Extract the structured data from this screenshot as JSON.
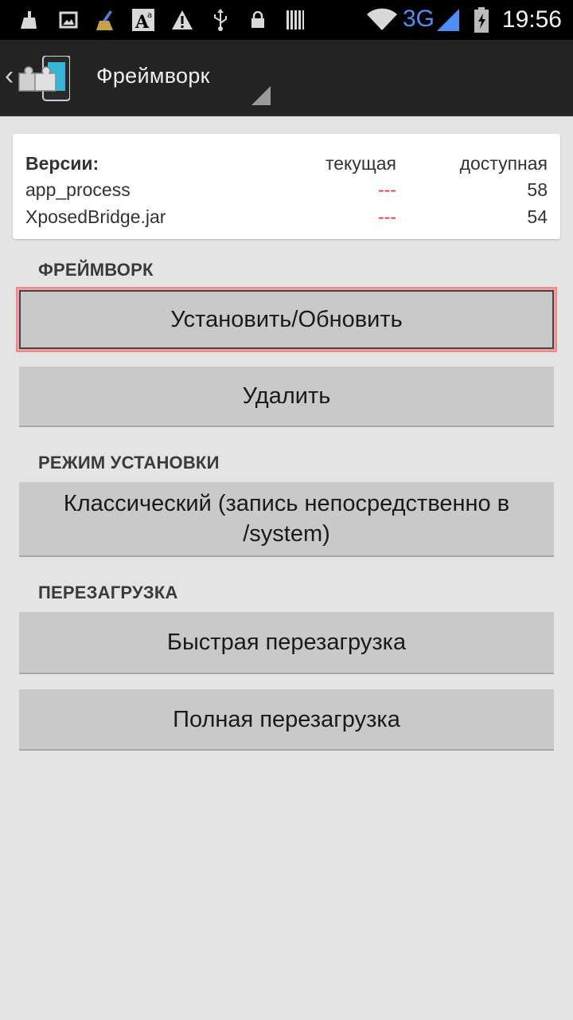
{
  "status_bar": {
    "time": "19:56",
    "network": "3G",
    "icons": [
      "cleaner-icon",
      "image-icon",
      "broom-icon",
      "font-icon",
      "warning-icon",
      "usb-icon",
      "lock-icon",
      "barcode-icon",
      "wifi-icon",
      "signal-icon",
      "battery-icon"
    ]
  },
  "action_bar": {
    "title": "Фреймворк",
    "back_icon": "chevron-left-icon",
    "app_icon": "xposed-puzzle-icon"
  },
  "versions": {
    "header": {
      "name": "Версии:",
      "current": "текущая",
      "available": "доступная"
    },
    "rows": [
      {
        "name": "app_process",
        "current": "---",
        "available": "58"
      },
      {
        "name": "XposedBridge.jar",
        "current": "---",
        "available": "54"
      }
    ]
  },
  "sections": {
    "framework": {
      "title": "ФРЕЙМВОРК",
      "install_label": "Установить/Обновить",
      "uninstall_label": "Удалить"
    },
    "install_mode": {
      "title": "РЕЖИМ УСТАНОВКИ",
      "mode_label": "Классический (запись непосредственно в /system)"
    },
    "reboot": {
      "title": "ПЕРЕЗАГРУЗКА",
      "soft_label": "Быстрая перезагрузка",
      "full_label": "Полная перезагрузка"
    }
  },
  "colors": {
    "accent_3g": "#4e8ff5",
    "missing_version": "#ff2a2a",
    "highlight": "#f08a8a",
    "logo": "#35b6d8"
  }
}
